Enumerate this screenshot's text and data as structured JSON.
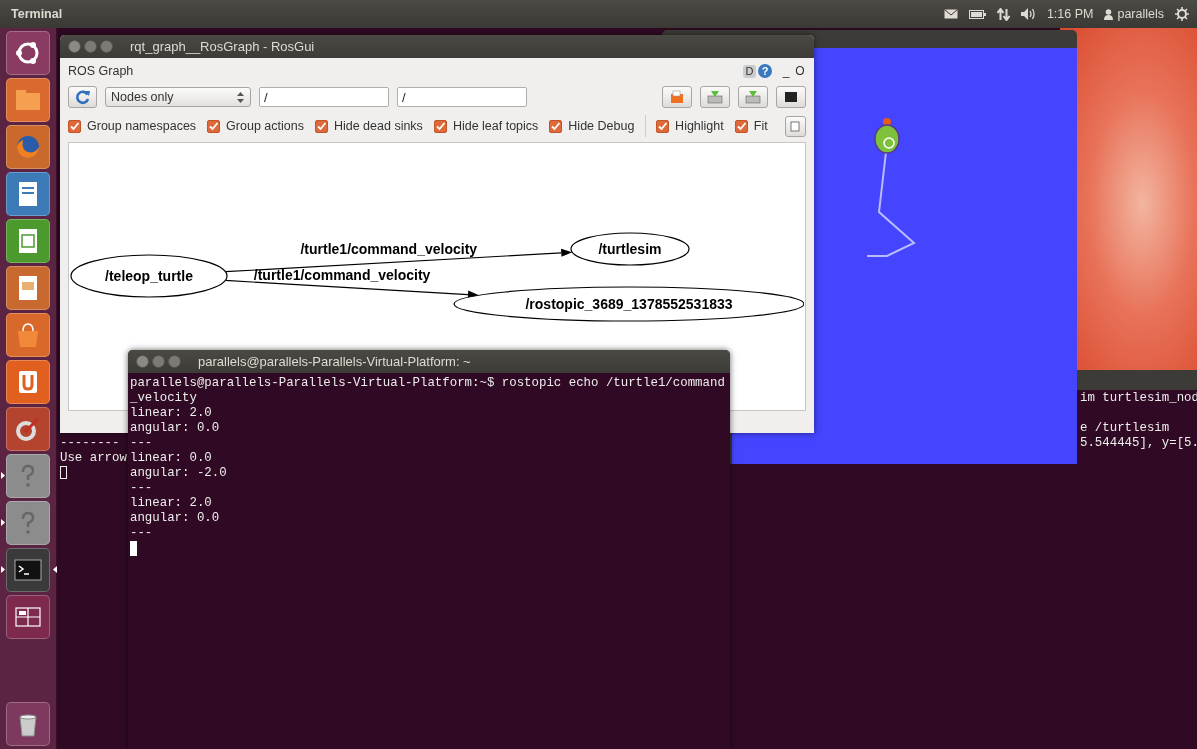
{
  "top_panel": {
    "app_name": "Terminal",
    "clock": "1:16 PM",
    "user": "parallels"
  },
  "launcher": {
    "items": [
      {
        "kind": "dash",
        "running": false,
        "focused": false
      },
      {
        "kind": "files",
        "running": false,
        "focused": false
      },
      {
        "kind": "browser",
        "running": false,
        "focused": false
      },
      {
        "kind": "writer",
        "running": false,
        "focused": false
      },
      {
        "kind": "calc",
        "running": false,
        "focused": false
      },
      {
        "kind": "impress",
        "running": false,
        "focused": false
      },
      {
        "kind": "store",
        "running": false,
        "focused": false
      },
      {
        "kind": "cloud",
        "running": false,
        "focused": false
      },
      {
        "kind": "settings",
        "running": false,
        "focused": false
      },
      {
        "kind": "unknown",
        "running": true,
        "focused": false
      },
      {
        "kind": "unknown",
        "running": true,
        "focused": false
      },
      {
        "kind": "terminal",
        "running": true,
        "focused": true
      },
      {
        "kind": "workspaces",
        "running": false,
        "focused": false
      },
      {
        "kind": "trash",
        "running": false,
        "focused": false
      }
    ]
  },
  "back_terminal": {
    "lines": [
      "--------",
      "Use arrow"
    ]
  },
  "right_terminal": {
    "blocks": [
      [
        "im turtlesim_nod"
      ],
      [
        "e /turtlesim",
        "5.544445], y=[5."
      ]
    ]
  },
  "rqt_window": {
    "title": "rqt_graph__RosGraph - RosGui",
    "plugin_title": "ROS Graph",
    "plugin_controls": [
      "D",
      "?",
      "_",
      "O"
    ],
    "toolbar": {
      "mode": "Nodes only",
      "node_filter": "/",
      "topic_filter": "/"
    },
    "options": [
      {
        "label": "Group namespaces",
        "checked": true
      },
      {
        "label": "Group actions",
        "checked": true
      },
      {
        "label": "Hide dead sinks",
        "checked": true
      },
      {
        "label": "Hide leaf topics",
        "checked": true
      },
      {
        "label": "Hide Debug",
        "checked": true
      }
    ],
    "view_options": [
      {
        "label": "Highlight",
        "checked": true
      },
      {
        "label": "Fit",
        "checked": true
      }
    ],
    "graph": {
      "nodes": [
        {
          "label": "/teleop_turtle"
        },
        {
          "label": "/turtlesim"
        },
        {
          "label": "/rostopic_3689_1378552531833"
        }
      ],
      "edges": [
        {
          "label": "/turtle1/command_velocity"
        },
        {
          "label": "/turtle1/command_velocity"
        }
      ]
    }
  },
  "front_terminal": {
    "title": "parallels@parallels-Parallels-Virtual-Platform: ~",
    "lines": [
      "parallels@parallels-Parallels-Virtual-Platform:~$ rostopic echo /turtle1/command",
      "_velocity",
      "linear: 2.0",
      "angular: 0.0",
      "---",
      "linear: 0.0",
      "angular: -2.0",
      "---",
      "linear: 2.0",
      "angular: 0.0",
      "---"
    ]
  }
}
